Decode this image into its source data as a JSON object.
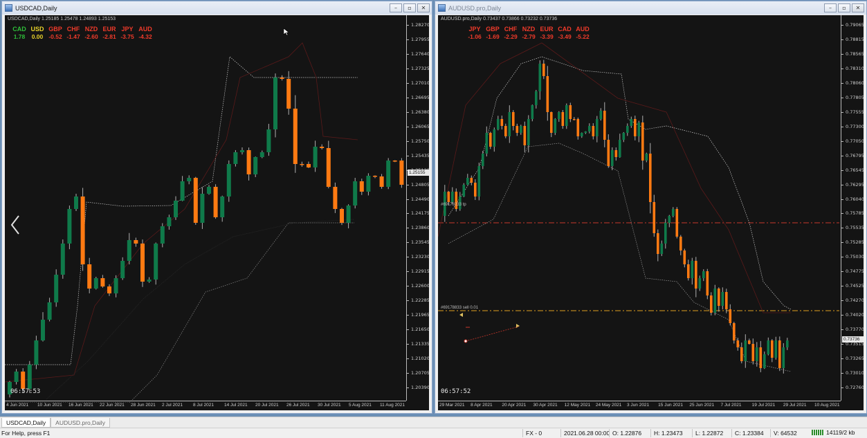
{
  "windows": [
    {
      "id": "usdcad",
      "title": "USDCAD,Daily",
      "symbol_line": "USDCAD,Daily  1.25185 1.25478 1.24893 1.25153",
      "strength": [
        {
          "cur": "CAD",
          "val": "1.78",
          "color": "#2fbf3a"
        },
        {
          "cur": "USD",
          "val": "0.00",
          "color": "#e8d22a"
        },
        {
          "cur": "GBP",
          "val": "-0.52",
          "color": "#f03a2a"
        },
        {
          "cur": "CHF",
          "val": "-1.47",
          "color": "#f03a2a"
        },
        {
          "cur": "NZD",
          "val": "-2.60",
          "color": "#f03a2a"
        },
        {
          "cur": "EUR",
          "val": "-2.81",
          "color": "#f03a2a"
        },
        {
          "cur": "JPY",
          "val": "-3.75",
          "color": "#f03a2a"
        },
        {
          "cur": "AUD",
          "val": "-4.32",
          "color": "#f03a2a"
        }
      ],
      "timer": "06:57:53",
      "current_price": "1.25155",
      "y_ticks": [
        "1.28270",
        "1.27955",
        "1.27640",
        "1.27325",
        "1.27010",
        "1.26695",
        "1.26380",
        "1.26065",
        "1.25750",
        "1.25435",
        "1.25120",
        "1.24805",
        "1.24490",
        "1.24175",
        "1.23860",
        "1.23545",
        "1.23230",
        "1.22915",
        "1.22600",
        "1.22285",
        "1.21965",
        "1.21650",
        "1.21335",
        "1.21020",
        "1.20705",
        "1.20390"
      ],
      "x_ticks": [
        "4 Jun 2021",
        "10 Jun 2021",
        "16 Jun 2021",
        "22 Jun 2021",
        "28 Jun 2021",
        "2 Jul 2021",
        "8 Jul 2021",
        "14 Jul 2021",
        "20 Jul 2021",
        "26 Jul 2021",
        "30 Jul 2021",
        "5 Aug 2021",
        "11 Aug 2021"
      ]
    },
    {
      "id": "audusd",
      "title": "AUDUSD.pro,Daily",
      "symbol_line": "AUDUSD.pro,Daily  0.73437 0.73866 0.73232 0.73736",
      "strength": [
        {
          "cur": "JPY",
          "val": "-1.06",
          "color": "#f03a2a"
        },
        {
          "cur": "GBP",
          "val": "-1.69",
          "color": "#f03a2a"
        },
        {
          "cur": "CHF",
          "val": "-2.29",
          "color": "#f03a2a"
        },
        {
          "cur": "NZD",
          "val": "-2.79",
          "color": "#f03a2a"
        },
        {
          "cur": "EUR",
          "val": "-3.39",
          "color": "#f03a2a"
        },
        {
          "cur": "CAD",
          "val": "-3.49",
          "color": "#f03a2a"
        },
        {
          "cur": "AUD",
          "val": "-5.22",
          "color": "#f03a2a"
        }
      ],
      "timer": "06:57:52",
      "current_price": "0.73736",
      "order_label_1": "#69178233 tp",
      "order_label_2": "#69178833 sell 0.01",
      "y_ticks": [
        "0.79065",
        "0.78815",
        "0.78565",
        "0.78310",
        "0.78060",
        "0.77805",
        "0.77555",
        "0.77300",
        "0.77050",
        "0.76795",
        "0.76545",
        "0.76295",
        "0.76040",
        "0.75785",
        "0.75535",
        "0.75285",
        "0.75030",
        "0.74775",
        "0.74525",
        "0.74270",
        "0.74020",
        "0.73770",
        "0.73515",
        "0.73265",
        "0.73010",
        "0.72760"
      ],
      "x_ticks": [
        "29 Mar 2021",
        "8 Apr 2021",
        "20 Apr 2021",
        "30 Apr 2021",
        "12 May 2021",
        "24 May 2021",
        "3 Jun 2021",
        "15 Jun 2021",
        "25 Jun 2021",
        "7 Jul 2021",
        "19 Jul 2021",
        "29 Jul 2021",
        "10 Aug 2021"
      ]
    }
  ],
  "tabs": [
    "USDCAD,Daily",
    "AUDUSD.pro,Daily"
  ],
  "status": {
    "help": "For Help, press F1",
    "profile": "FX - 0",
    "datetime": "2021.06.28 00:00",
    "open": "O: 1.22876",
    "high": "H: 1.23473",
    "low": "L: 1.22872",
    "close": "C: 1.23384",
    "volume": "V: 64532",
    "traffic": "14119/2 kb"
  },
  "colors": {
    "bull": "#0f7a4a",
    "bear": "#ff7a12",
    "bg": "#141414"
  },
  "icons": {
    "nav": "chevron-left-icon",
    "traffic": "connection-bars-icon"
  }
}
